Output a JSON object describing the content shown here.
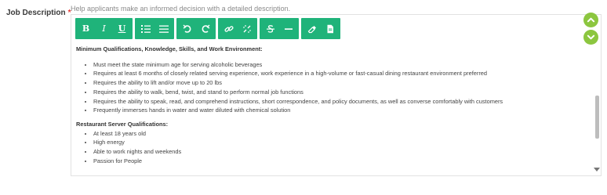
{
  "field": {
    "label": "Job Description",
    "required_marker": "*",
    "help_text": "Help applicants make an informed decision with a detailed description."
  },
  "toolbar": {
    "bold": "B",
    "italic": "I",
    "underline": "U"
  },
  "content": {
    "section1_title": "Minimum Qualifications, Knowledge, Skills, and Work Environment:",
    "section1_items": [
      "Must meet the state minimum age for serving alcoholic beverages",
      "Requires at least 6 months of closely related serving experience, work experience in a high-volume or fast-casual dining restaurant environment preferred",
      "Requires the ability to lift and/or move up to 20 lbs",
      "Requires the ability to walk, bend, twist, and stand to perform normal job functions",
      "Requires the ability to speak, read, and comprehend instructions, short correspondence, and policy documents, as well as converse comfortably with customers",
      "Frequently immerses hands in water and water diluted with chemical solution"
    ],
    "section2_title": "Restaurant Server Qualifications:",
    "section2_items": [
      "At least 18 years old",
      "High energy",
      "Able to work nights and weekends",
      "Passion for People"
    ]
  },
  "colors": {
    "toolbar_green": "#1fb37a",
    "nav_green": "#8cc63f",
    "required_red": "#e53935"
  },
  "icons": [
    "bold-icon",
    "italic-icon",
    "underline-icon",
    "ordered-list-icon",
    "unordered-list-icon",
    "undo-icon",
    "redo-icon",
    "link-icon",
    "unlink-icon",
    "strikethrough-icon",
    "horizontal-rule-icon",
    "eraser-icon",
    "document-icon",
    "chevron-up-icon",
    "chevron-down-icon"
  ]
}
